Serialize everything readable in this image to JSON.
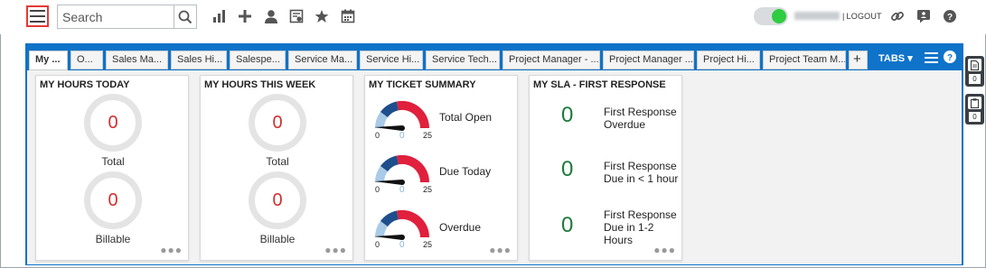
{
  "header": {
    "search_placeholder": "Search",
    "logout_label": "LOGOUT",
    "separator": "|",
    "toggle_on": true
  },
  "tabs": {
    "items": [
      {
        "label": "My ...",
        "active": true
      },
      {
        "label": "O...",
        "active": false
      },
      {
        "label": "Sales Ma...",
        "active": false
      },
      {
        "label": "Sales Hi...",
        "active": false
      },
      {
        "label": "Salespe...",
        "active": false
      },
      {
        "label": "Service Ma...",
        "active": false
      },
      {
        "label": "Service Hi...",
        "active": false
      },
      {
        "label": "Service Tech...",
        "active": false
      },
      {
        "label": "Project Manager - ...",
        "active": false
      },
      {
        "label": "Project Manager ...",
        "active": false
      },
      {
        "label": "Project Hi...",
        "active": false
      },
      {
        "label": "Project Team M...",
        "active": false
      }
    ],
    "add_label": "+",
    "tabs_menu_label": "TABS"
  },
  "widgets": {
    "hours_today": {
      "title": "MY HOURS TODAY",
      "total_value": "0",
      "total_label": "Total",
      "billable_value": "0",
      "billable_label": "Billable",
      "more": "●●●"
    },
    "hours_week": {
      "title": "MY HOURS THIS WEEK",
      "total_value": "0",
      "total_label": "Total",
      "billable_value": "0",
      "billable_label": "Billable",
      "more": "●●●"
    },
    "ticket_summary": {
      "title": "MY TICKET SUMMARY",
      "gauges": [
        {
          "label": "Total Open",
          "value": "0",
          "min": "0",
          "max": "25"
        },
        {
          "label": "Due Today",
          "value": "0",
          "min": "0",
          "max": "25"
        },
        {
          "label": "Overdue",
          "value": "0",
          "min": "0",
          "max": "25"
        }
      ],
      "more": "●●●"
    },
    "sla": {
      "title": "MY SLA - FIRST RESPONSE",
      "rows": [
        {
          "value": "0",
          "label_line1": "First Response",
          "label_line2": "Overdue",
          "label_line3": ""
        },
        {
          "value": "0",
          "label_line1": "First Response",
          "label_line2": "Due in < 1 hour",
          "label_line3": ""
        },
        {
          "value": "0",
          "label_line1": "First Response",
          "label_line2": "Due in 1-2",
          "label_line3": "Hours"
        }
      ],
      "more": "●●●"
    }
  },
  "side_panel": {
    "notes_count": "0",
    "clipboard_count": "0"
  },
  "colors": {
    "accent": "#0e73c9",
    "ring_value": "#d32f2f",
    "sla_value": "#1b7a3a",
    "gauge_red": "#e0203c",
    "gauge_dark": "#1f4e8c",
    "gauge_light": "#a9cbe8"
  }
}
